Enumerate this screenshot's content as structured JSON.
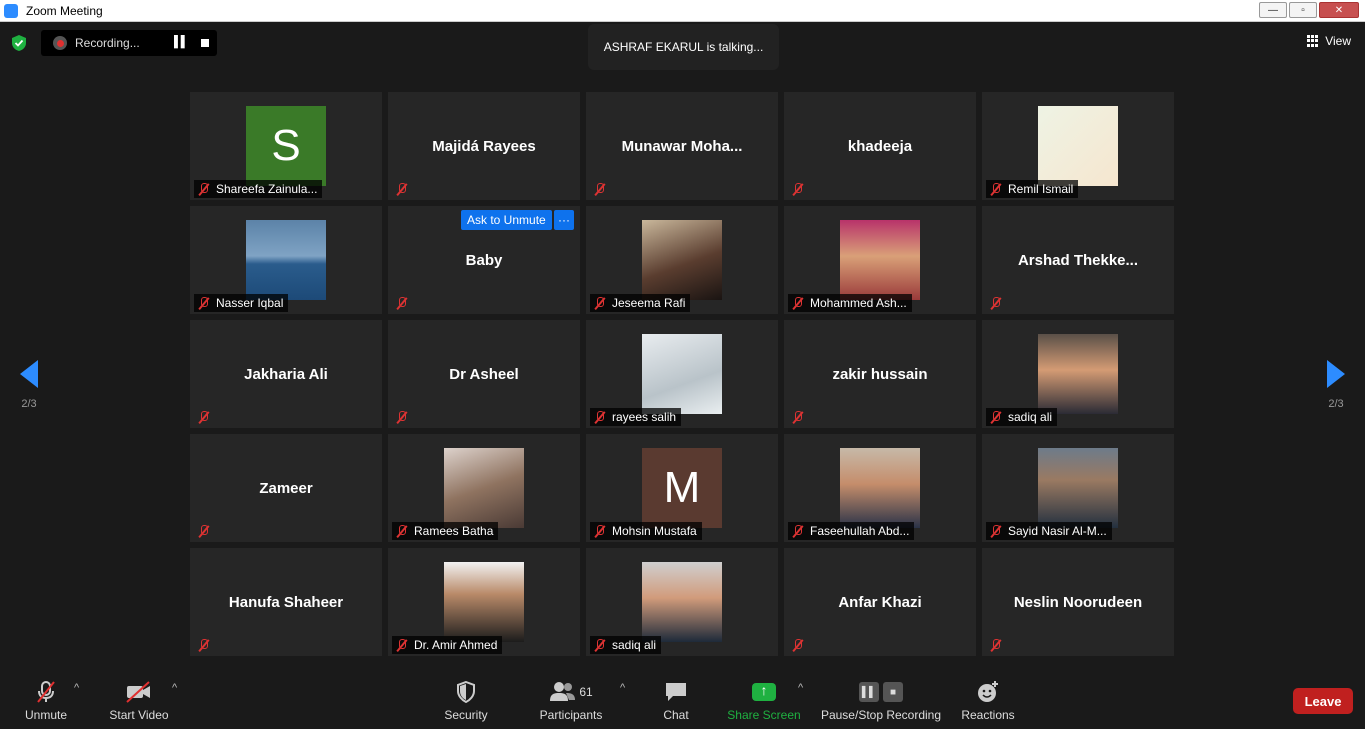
{
  "window": {
    "title": "Zoom Meeting"
  },
  "topbar": {
    "recording_label": "Recording...",
    "talking_text": "ASHRAF EKARUL is talking...",
    "view_label": "View"
  },
  "nav": {
    "left_page": "2/3",
    "right_page": "2/3"
  },
  "tile_controls": {
    "ask_unmute_label": "Ask to Unmute",
    "more_label": "···"
  },
  "tiles": [
    {
      "name": "Shareefa Zainula...",
      "center": "",
      "avatar": "S",
      "avatar_color": "#3a7a28"
    },
    {
      "name": "",
      "center": "Majidá Rayees"
    },
    {
      "name": "",
      "center": "Munawar  Moha..."
    },
    {
      "name": "",
      "center": "khadeeja"
    },
    {
      "name": "Remil Ismail",
      "center": ""
    },
    {
      "name": "Nasser Iqbal",
      "center": ""
    },
    {
      "name": "",
      "center": "Baby"
    },
    {
      "name": "Jeseema Rafi",
      "center": ""
    },
    {
      "name": "Mohammed Ash...",
      "center": ""
    },
    {
      "name": "",
      "center": "Arshad  Thekke..."
    },
    {
      "name": "",
      "center": "Jakharia Ali"
    },
    {
      "name": "",
      "center": "Dr Asheel"
    },
    {
      "name": "rayees salih",
      "center": ""
    },
    {
      "name": "",
      "center": "zakir hussain"
    },
    {
      "name": "sadiq ali",
      "center": ""
    },
    {
      "name": "",
      "center": "Zameer"
    },
    {
      "name": "Ramees Batha",
      "center": ""
    },
    {
      "name": "Mohsin Mustafa",
      "center": "",
      "avatar": "M",
      "avatar_color": "#5a3a30"
    },
    {
      "name": "Faseehullah Abd...",
      "center": ""
    },
    {
      "name": "Sayid Nasir Al-M...",
      "center": ""
    },
    {
      "name": "",
      "center": "Hanufa Shaheer"
    },
    {
      "name": "Dr. Amir Ahmed",
      "center": ""
    },
    {
      "name": "sadiq ali",
      "center": ""
    },
    {
      "name": "",
      "center": "Anfar Khazi"
    },
    {
      "name": "",
      "center": "Neslin Noorudeen"
    }
  ],
  "toolbar": {
    "unmute": "Unmute",
    "start_video": "Start Video",
    "security": "Security",
    "participants": "Participants",
    "participants_count": "61",
    "chat": "Chat",
    "share_screen": "Share Screen",
    "pause_stop_recording": "Pause/Stop Recording",
    "reactions": "Reactions",
    "leave": "Leave"
  },
  "colors": {
    "accent": "#2d8cff",
    "share": "#1fb141",
    "leave": "#c0201f",
    "mute": "#d33333"
  }
}
